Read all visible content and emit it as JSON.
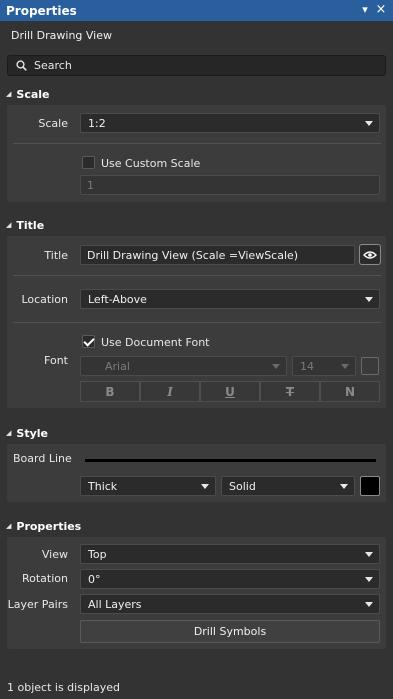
{
  "panel": {
    "title": "Properties",
    "pin_glyph": "▾",
    "close_glyph": "×"
  },
  "view_name": "Drill Drawing View",
  "search": {
    "placeholder": "Search"
  },
  "scale": {
    "header": "Scale",
    "scale_label": "Scale",
    "scale_value": "1:2",
    "use_custom_label": "Use Custom Scale",
    "use_custom_checked": false,
    "custom_value": "1"
  },
  "title_section": {
    "header": "Title",
    "title_label": "Title",
    "title_value": "Drill Drawing View (Scale =ViewScale)",
    "location_label": "Location",
    "location_value": "Left-Above",
    "use_doc_font_label": "Use Document Font",
    "use_doc_font_checked": true,
    "font_label": "Font",
    "font_family": "Arial",
    "font_size": "14",
    "font_color": "#3a3a3a",
    "format_buttons": [
      "B",
      "I",
      "U",
      "T",
      "N"
    ]
  },
  "style": {
    "header": "Style",
    "board_line_label": "Board Line",
    "line_weight": "Thick",
    "line_style": "Solid",
    "line_color": "#000000"
  },
  "properties": {
    "header": "Properties",
    "view_label": "View",
    "view_value": "Top",
    "rotation_label": "Rotation",
    "rotation_value": "0°",
    "layer_pairs_label": "Layer Pairs",
    "layer_pairs_value": "All Layers",
    "drill_symbols_label": "Drill Symbols"
  },
  "status": "1 object is displayed"
}
